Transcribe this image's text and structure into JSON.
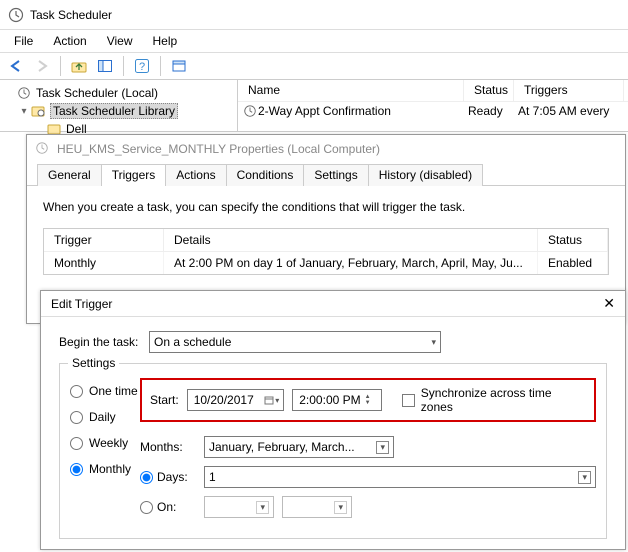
{
  "window": {
    "title": "Task Scheduler"
  },
  "menu": {
    "file": "File",
    "action": "Action",
    "view": "View",
    "help": "Help"
  },
  "tree": {
    "root": "Task Scheduler (Local)",
    "library": "Task Scheduler Library",
    "child1": "Dell"
  },
  "list": {
    "hdr_name": "Name",
    "hdr_status": "Status",
    "hdr_triggers": "Triggers",
    "row_name": "2-Way Appt Confirmation",
    "row_status": "Ready",
    "row_trigger": "At 7:05 AM every"
  },
  "props": {
    "title": "HEU_KMS_Service_MONTHLY Properties (Local Computer)",
    "tabs": {
      "general": "General",
      "triggers": "Triggers",
      "actions": "Actions",
      "conditions": "Conditions",
      "settings": "Settings",
      "history": "History (disabled)"
    },
    "desc": "When you create a task, you can specify the conditions that will trigger the task.",
    "hdr_trigger": "Trigger",
    "hdr_details": "Details",
    "hdr_status": "Status",
    "row_trigger": "Monthly",
    "row_details": "At 2:00 PM  on day 1 of January, February, March, April, May, Ju...",
    "row_status": "Enabled"
  },
  "edit": {
    "title": "Edit Trigger",
    "begin_label": "Begin the task:",
    "begin_value": "On a schedule",
    "settings_label": "Settings",
    "radio_onetime": "One time",
    "radio_daily": "Daily",
    "radio_weekly": "Weekly",
    "radio_monthly": "Monthly",
    "start_label": "Start:",
    "date_value": "10/20/2017",
    "time_value": "2:00:00 PM",
    "sync_label": "Synchronize across time zones",
    "months_label": "Months:",
    "months_value": "January, February, March...",
    "days_label": "Days:",
    "days_value": "1",
    "on_label": "On:"
  }
}
